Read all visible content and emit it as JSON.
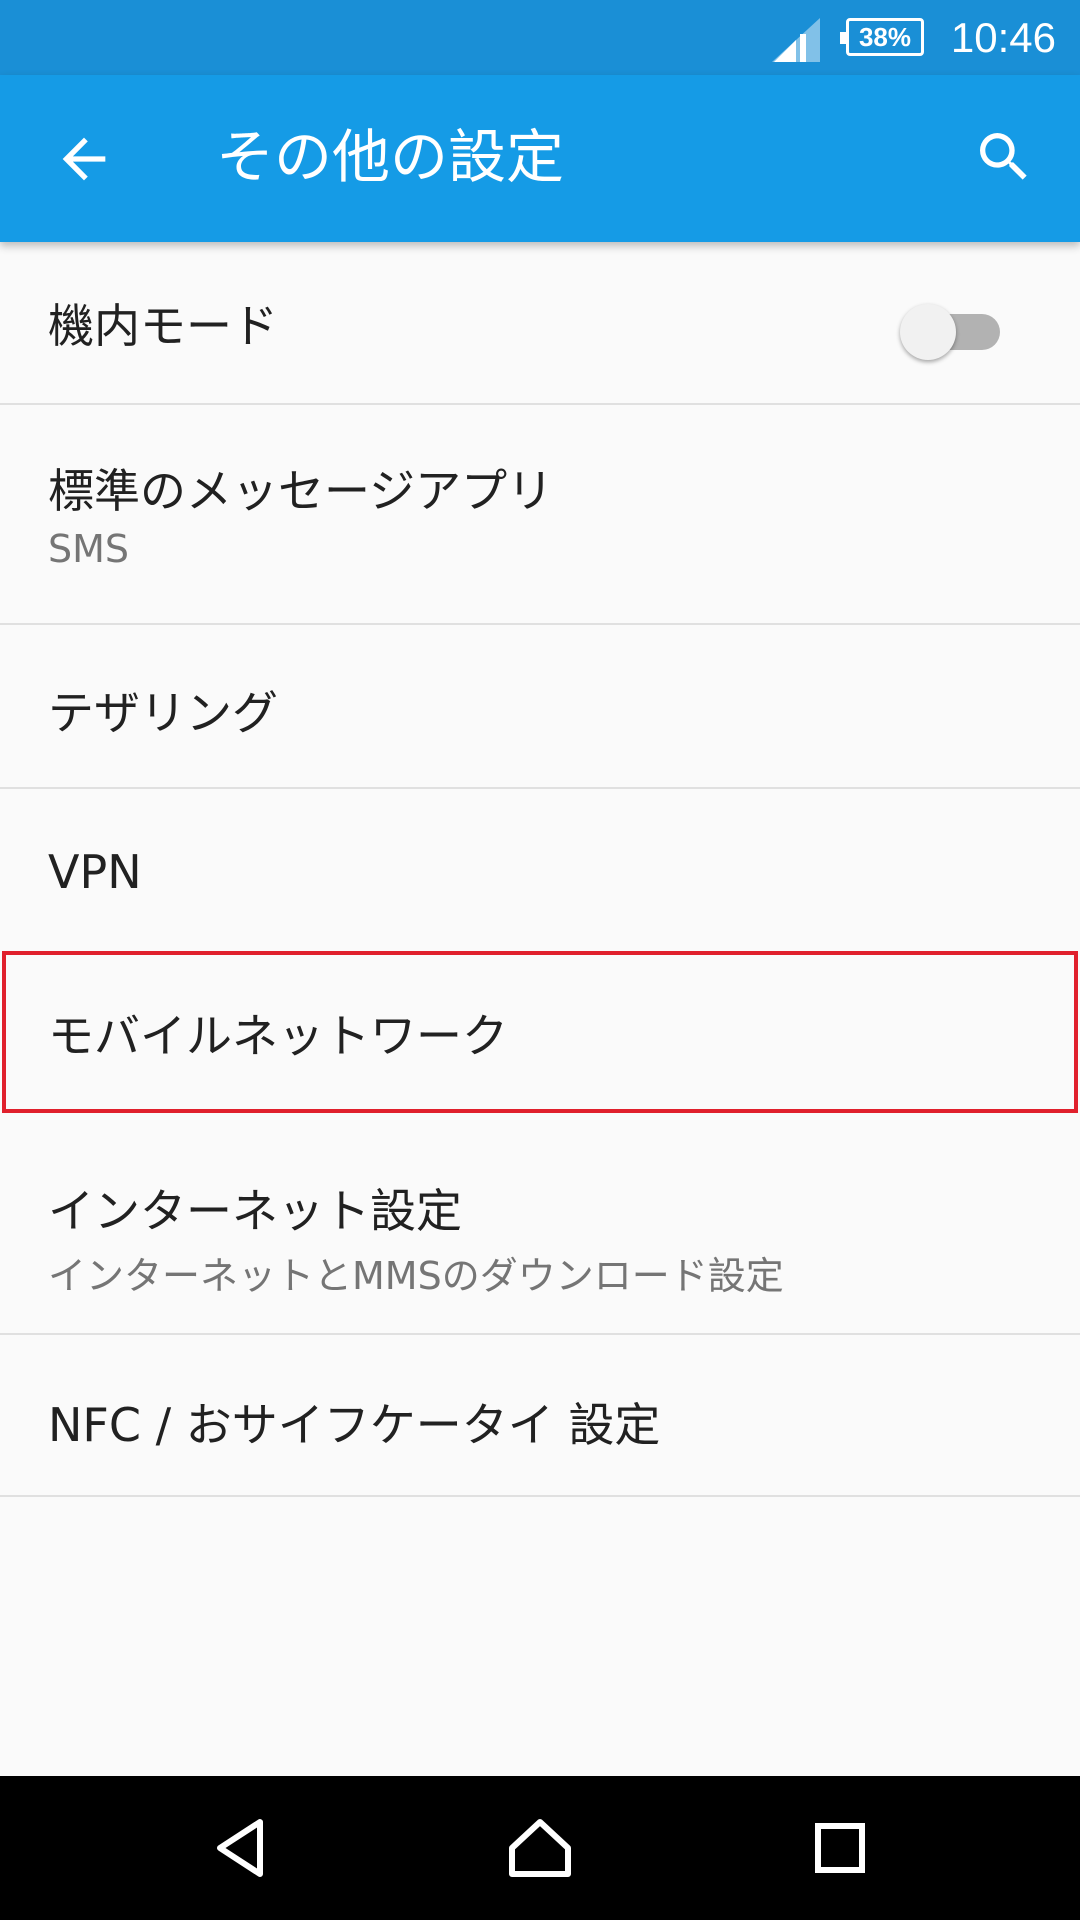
{
  "status_bar": {
    "battery": "38%",
    "time": "10:46",
    "icons": [
      "signal-icon",
      "battery-icon"
    ]
  },
  "app_bar": {
    "title": "その他の設定",
    "icons": [
      "back-arrow-icon",
      "search-icon"
    ]
  },
  "settings": {
    "airplane_mode": {
      "label": "機内モード",
      "enabled": false
    },
    "default_sms_app": {
      "label": "標準のメッセージアプリ",
      "summary": "SMS"
    },
    "tethering": {
      "label": "テザリング"
    },
    "vpn": {
      "label": "VPN"
    },
    "mobile_network": {
      "label": "モバイルネットワーク"
    },
    "internet_settings": {
      "label": "インターネット設定",
      "summary": "インターネットとMMSのダウンロード設定"
    },
    "nfc": {
      "label": "NFC / おサイフケータイ 設定"
    }
  },
  "nav_bar": {
    "icons": [
      "nav-back-icon",
      "nav-home-icon",
      "nav-recents-icon"
    ]
  },
  "colors": {
    "status_bar": "#1a8fd6",
    "app_bar": "#159be6",
    "highlight_border": "#e0202c",
    "background": "#fafafa"
  }
}
